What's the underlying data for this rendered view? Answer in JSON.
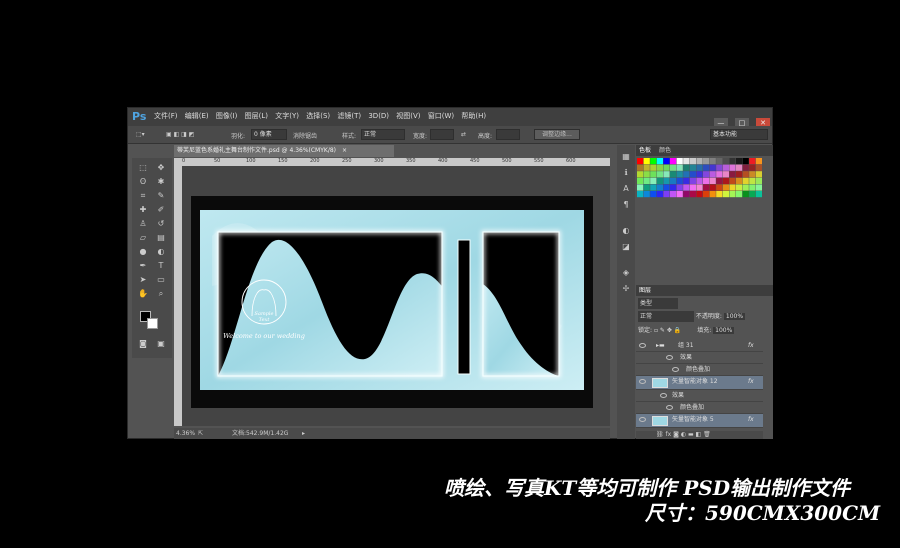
{
  "app": {
    "logo": "Ps",
    "menu": [
      "文件(F)",
      "编辑(E)",
      "图像(I)",
      "图层(L)",
      "文字(Y)",
      "选择(S)",
      "滤镜(T)",
      "3D(D)",
      "视图(V)",
      "窗口(W)",
      "帮助(H)"
    ],
    "window_controls": [
      "—",
      "□",
      "✕"
    ]
  },
  "options_bar": {
    "feather_label": "羽化:",
    "feather_value": "0 像素",
    "antialias": "消除锯齿",
    "style_label": "样式:",
    "style_value": "正常",
    "width_label": "宽度:",
    "height_label": "高度:",
    "refine_edge": "调整边缘...",
    "workspace": "基本功能"
  },
  "document": {
    "tab_title": "蒂芙尼蓝色系婚礼主舞台制作文件.psd @ 4.36%(CMYK/8)",
    "close_icon": "×",
    "ruler_ticks": [
      "0",
      "50",
      "100",
      "150",
      "200",
      "250",
      "300",
      "350",
      "400",
      "450",
      "500",
      "550",
      "600"
    ],
    "artwork_title_line1": "Sample",
    "artwork_title_line2": "Text",
    "artwork_welcome": "Welcome to our wedding"
  },
  "status_bar": {
    "zoom": "4.36%",
    "doc_size": "文档:542.9M/1.42G"
  },
  "panels": {
    "color_tabs": [
      "色板",
      "颜色"
    ],
    "layers_tab": "图层",
    "layers_kind": "类型",
    "blend_mode": "正常",
    "opacity_label": "不透明度:",
    "opacity_value": "100%",
    "lock_label": "锁定:",
    "fill_label": "填充:",
    "fill_value": "100%",
    "layers": [
      {
        "name": "组 31",
        "fx": "fx",
        "selected": false
      },
      {
        "name": "效果",
        "fx": "",
        "selected": false
      },
      {
        "name": "颜色叠加",
        "fx": "",
        "selected": false
      },
      {
        "name": "矢量智能对象 12",
        "fx": "fx",
        "selected": true
      },
      {
        "name": "效果",
        "fx": "",
        "selected": false
      },
      {
        "name": "颜色叠加",
        "fx": "",
        "selected": false
      },
      {
        "name": "矢量智能对象 5",
        "fx": "fx",
        "selected": true
      }
    ]
  },
  "caption": {
    "line1": "喷绘、写真KT等均可制作  PSD输出制作文件",
    "line2": "尺寸：590CMX300CM"
  },
  "colors": {
    "accent_tiffany": "#9fd8e4",
    "tiffany_dark": "#6fb9c9",
    "ps_blue": "#4fa3e0"
  }
}
